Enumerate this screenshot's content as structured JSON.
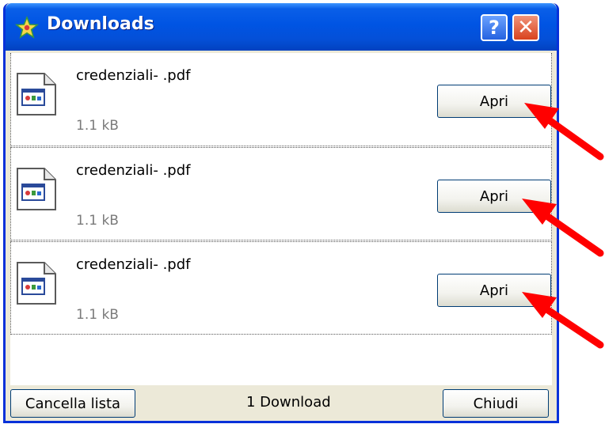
{
  "window": {
    "title": "Downloads",
    "help_label": "?",
    "close_label": "✕"
  },
  "downloads": [
    {
      "name": "credenziali- .pdf",
      "size": "1.1 kB",
      "action": "Apri"
    },
    {
      "name": "credenziali- .pdf",
      "size": "1.1 kB",
      "action": "Apri"
    },
    {
      "name": "credenziali- .pdf",
      "size": "1.1 kB",
      "action": "Apri"
    }
  ],
  "footer": {
    "clear_label": "Cancella lista",
    "status": "1 Download",
    "close_label": "Chiudi"
  },
  "colors": {
    "titlebar": "#0054e3",
    "frame": "#0831d9",
    "panel": "#ece9d8",
    "arrow": "#ff0000"
  },
  "icons": {
    "title": "star-icon",
    "file": "document-icon",
    "annotation": "red-arrow"
  }
}
